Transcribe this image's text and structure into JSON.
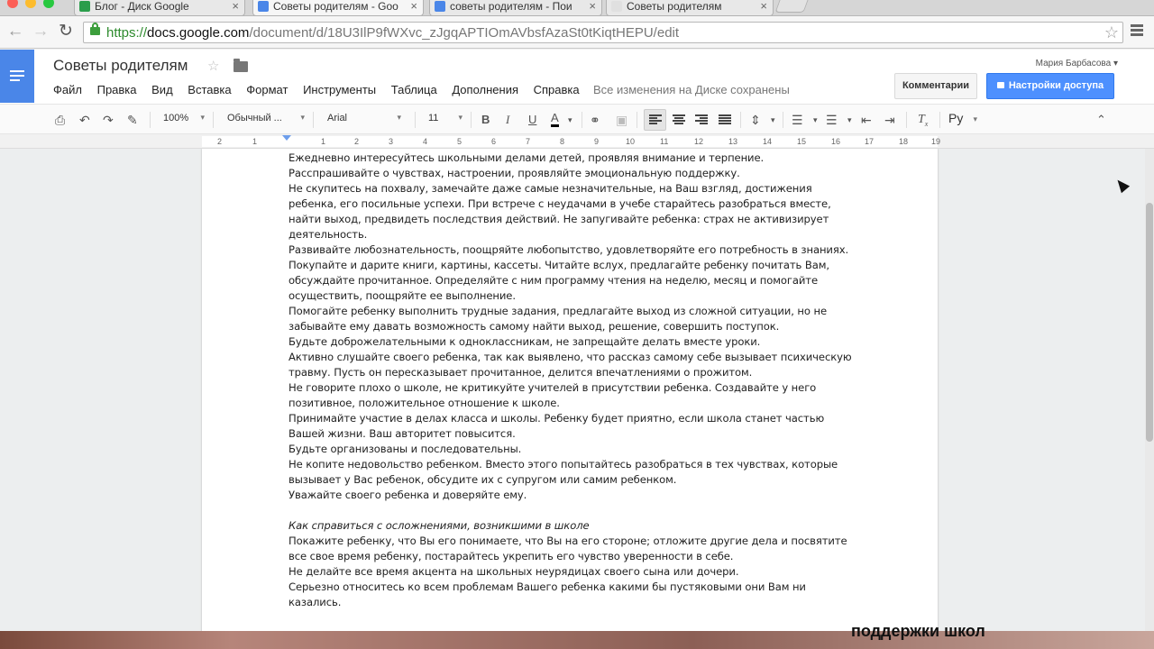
{
  "browser": {
    "tabs": [
      {
        "title": "Блог - Диск Google",
        "icon_color": "#2a9d4b"
      },
      {
        "title": "Советы родителям - Goo",
        "icon_color": "#4a86e8"
      },
      {
        "title": "советы родителям - Пои",
        "icon_color": "#4a86e8"
      },
      {
        "title": "Советы родителям",
        "icon_color": ""
      }
    ],
    "url": {
      "scheme": "https://",
      "host": "docs.google.com",
      "path": "/document/d/18U3IlP9fWXvc_zJgqAPTIOmAVbsfAzaSt0tKiqtHEPU/edit"
    }
  },
  "docs": {
    "title": "Советы родителям",
    "user": "Мария Барбасова",
    "menu": [
      "Файл",
      "Правка",
      "Вид",
      "Вставка",
      "Формат",
      "Инструменты",
      "Таблица",
      "Дополнения",
      "Справка"
    ],
    "saved_status": "Все изменения на Диске сохранены",
    "comments_button": "Комментарии",
    "share_button": "Настройки доступа",
    "accent": "#4a86e8"
  },
  "format": {
    "zoom": "100%",
    "style": "Обычный ...",
    "font": "Arial",
    "size": "11",
    "lang": "Ру"
  },
  "ruler": {
    "numbers": [
      "2",
      "1",
      "1",
      "2",
      "3",
      "4",
      "5",
      "6",
      "7",
      "8",
      "9",
      "10",
      "11",
      "12",
      "13",
      "14",
      "15",
      "16",
      "17",
      "18",
      "19"
    ]
  },
  "document": {
    "paragraphs": [
      "Ежедневно интересуйтесь школьными делами детей, проявляя внимание и терпение.",
      "Расспрашивайте о чувствах, настроении, проявляйте эмоциональную поддержку.",
      "Не скупитесь на похвалу, замечайте даже самые незначительные, на Ваш взгляд, достижения ребенка, его посильные успехи. При встрече с неудачами в учебе старайтесь разобраться вместе, найти выход, предвидеть последствия действий. Не запугивайте ребенка: страх не активизирует деятельность.",
      "Развивайте любознательность, поощряйте любопытство, удовлетворяйте его потребность в знаниях.",
      "Покупайте и дарите книги, картины, кассеты. Читайте вслух, предлагайте ребенку почитать Вам, обсуждайте прочитанное. Определяйте с ним программу чтения на неделю, месяц и помогайте осуществить, поощряйте ее выполнение.",
      "Помогайте ребенку выполнить трудные задания, предлагайте выход из сложной ситуации, но не забывайте ему давать возможность самому найти выход, решение, совершить поступок.",
      "Будьте доброжелательными к одноклассникам, не запрещайте делать вместе уроки.",
      "Активно слушайте своего ребенка, так как выявлено, что рассказ самому себе вызывает психическую травму. Пусть он пересказывает прочитанное, делится впечатлениями о прожитом.",
      "Не говорите плохо о школе, не критикуйте учителей в присутствии ребенка. Создавайте у него позитивное, положительное отношение к школе.",
      "Принимайте участие в делах класса и школы. Ребенку будет приятно, если школа станет частью Вашей жизни. Ваш авторитет повысится.",
      "Будьте организованы и последовательны.",
      "Не копите недовольство ребенком. Вместо этого попытайтесь разобраться в тех чувствах, которые вызывает у Вас ребенок, обсудите их с супругом или самим ребенком.",
      "Уважайте своего ребенка и доверяйте ему."
    ],
    "heading": "Как справиться с осложнениями, возникшими в школе",
    "paragraphs2": [
      "Покажите ребенку, что Вы его понимаете, что Вы на его стороне; отложите другие дела и посвятите все свое время ребенку, постарайтесь укрепить его чувство уверенности в себе.",
      "Не делайте все время акцента на школьных неурядицах своего сына или дочери.",
      "Серьезно относитесь ко всем проблемам Вашего ребенка какими бы пустяковыми они Вам ни казались."
    ]
  },
  "overlay_text": "поддержки школ"
}
